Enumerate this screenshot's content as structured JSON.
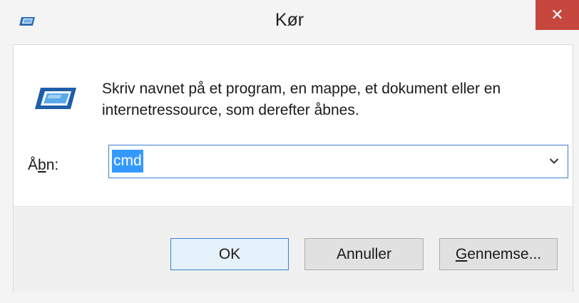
{
  "window": {
    "title": "Kør",
    "close_glyph": "✕"
  },
  "dialog": {
    "description_line1": "Skriv navnet på et program, en mappe, et dokument eller en",
    "description_line2": "internetressource, som derefter åbnes.",
    "open_label_prefix": "Å",
    "open_label_accel": "b",
    "open_label_suffix": "n:",
    "open_value": "cmd"
  },
  "buttons": {
    "ok_label": "OK",
    "cancel_label": "Annuller",
    "browse_accel": "G",
    "browse_rest": "ennemse..."
  },
  "icons": {
    "title_icon": "run-icon",
    "dropdown": "chevron-down-icon",
    "close": "close-icon"
  },
  "colors": {
    "close_bg": "#c7463d",
    "selection": "#3399ff",
    "focus_border": "#3c7fd0"
  }
}
